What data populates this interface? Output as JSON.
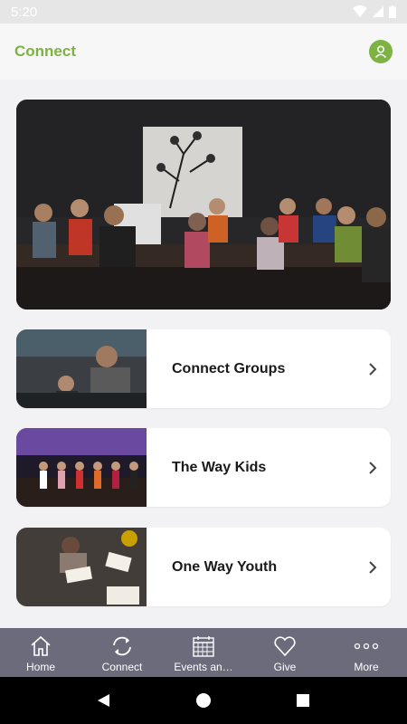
{
  "status_bar": {
    "time": "5:20"
  },
  "header": {
    "title": "Connect"
  },
  "cards": [
    {
      "label": "Connect Groups"
    },
    {
      "label": "The Way Kids"
    },
    {
      "label": "One Way Youth"
    }
  ],
  "tabs": [
    {
      "label": "Home",
      "icon": "home-icon"
    },
    {
      "label": "Connect",
      "icon": "sync-icon"
    },
    {
      "label": "Events an…",
      "icon": "calendar-icon"
    },
    {
      "label": "Give",
      "icon": "heart-icon"
    },
    {
      "label": "More",
      "icon": "more-dots-icon"
    }
  ],
  "colors": {
    "accent": "#7cb342",
    "tab_bar": "#6b6b7c"
  }
}
